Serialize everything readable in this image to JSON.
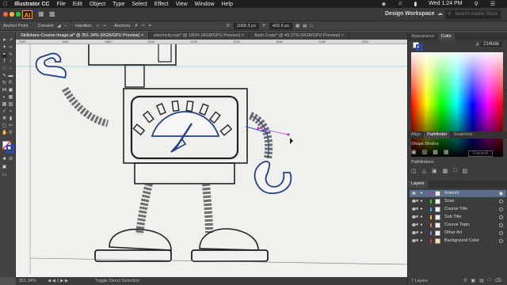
{
  "menubar": {
    "app_name": "Illustrator CC",
    "items": [
      "File",
      "Edit",
      "Object",
      "Type",
      "Select",
      "Effect",
      "View",
      "Window",
      "Help"
    ],
    "clock": "Wed 1:24 PM"
  },
  "appbar": {
    "logo_text": "Ai",
    "workspace": "Design Workspace",
    "search_placeholder": "Search Adobe Stock"
  },
  "control_bar": {
    "anchor_point_label": "Anchor Point",
    "convert_label": "Convert:",
    "handles_label": "Handles:",
    "anchors_label": "Anchors:",
    "x_value": "1068.5 px",
    "y_value": "402.5 px"
  },
  "tabs": [
    {
      "label": "Skillshare-Course-Image.ai* @ 351.34% (RGB/GPU Preview)",
      "active": true
    },
    {
      "label": "electricity.eps* @ 100% (RGB/GPU Preview)",
      "active": false
    },
    {
      "label": "flash-2.eps* @ 49.27% (RGB/GPU Preview)",
      "active": false
    }
  ],
  "ruler_ticks": [
    "1140",
    "1160",
    "1180",
    "1200",
    "1220",
    "1240",
    "1260",
    "1280",
    "1300"
  ],
  "status": {
    "zoom": "351.34%",
    "tool_name": "Toggle Direct Selection"
  },
  "panels": {
    "color_tabs": [
      "Appearance",
      "Color"
    ],
    "hex_value": "214bde",
    "pathfinder_tabs": [
      "Align",
      "Pathfinder",
      "Swatches"
    ],
    "shape_modes_label": "Shape Modes:",
    "expand_label": "Expand",
    "pathfinders_label": "Pathfinders:",
    "layers_tab": "Layers",
    "layers": [
      "Artwork",
      "Scan",
      "Course Title",
      "Sub Title",
      "Course Topic",
      "Other Art",
      "Background Color"
    ],
    "layers_count": "7 Layers"
  },
  "colors": {
    "accent_orange": "#ff9a00",
    "layer_highlight": "#5a6e8a",
    "selection_blue": "#214bde",
    "path_magenta": "#c832c8"
  }
}
